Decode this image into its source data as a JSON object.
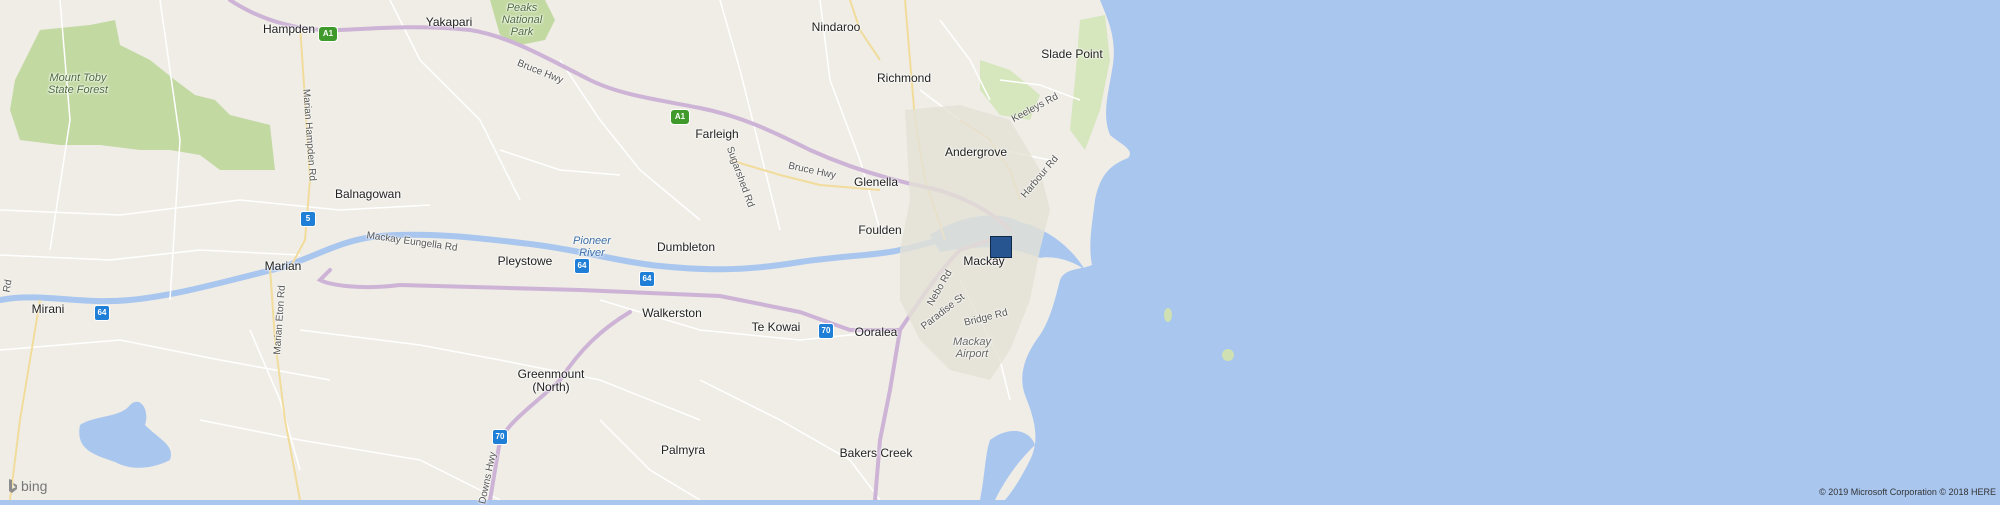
{
  "map": {
    "provider": "bing",
    "copyright": "© 2019 Microsoft Corporation © 2018 HERE",
    "colors": {
      "land": "#efede6",
      "sea": "#a9c6ef",
      "park": "#c3d9a2",
      "road_major": "#cdb3d6",
      "road_minor": "#ffffff",
      "marker": "#27558f"
    },
    "places": [
      {
        "id": "hampden",
        "name": "Hampden"
      },
      {
        "id": "yakapari",
        "name": "Yakapari"
      },
      {
        "id": "nindaroo",
        "name": "Nindaroo"
      },
      {
        "id": "slade-point",
        "name": "Slade Point"
      },
      {
        "id": "richmond",
        "name": "Richmond"
      },
      {
        "id": "farleigh",
        "name": "Farleigh"
      },
      {
        "id": "andergrove",
        "name": "Andergrove"
      },
      {
        "id": "glenella",
        "name": "Glenella"
      },
      {
        "id": "balnagowan",
        "name": "Balnagowan"
      },
      {
        "id": "foulden",
        "name": "Foulden"
      },
      {
        "id": "dumbleton",
        "name": "Dumbleton"
      },
      {
        "id": "pleystowe",
        "name": "Pleystowe"
      },
      {
        "id": "marian",
        "name": "Marian"
      },
      {
        "id": "mackay",
        "name": "Mackay"
      },
      {
        "id": "mirani",
        "name": "Mirani"
      },
      {
        "id": "walkerston",
        "name": "Walkerston"
      },
      {
        "id": "te-kowai",
        "name": "Te Kowai"
      },
      {
        "id": "ooralea",
        "name": "Ooralea"
      },
      {
        "id": "greenmount",
        "name": "Greenmount\n(North)"
      },
      {
        "id": "palmyra",
        "name": "Palmyra"
      },
      {
        "id": "bakers-creek",
        "name": "Bakers Creek"
      }
    ],
    "parks": [
      {
        "id": "mount-toby",
        "name": "Mount Toby\nState Forest"
      },
      {
        "id": "peaks-np",
        "name": "Peaks\nNational\nPark"
      }
    ],
    "water_labels": [
      {
        "id": "pioneer-river",
        "name": "Pioneer\nRiver"
      }
    ],
    "airports": [
      {
        "id": "mackay-airport",
        "name": "Mackay\nAirport"
      }
    ],
    "roads": [
      {
        "id": "bruce-hwy-1",
        "name": "Bruce Hwy"
      },
      {
        "id": "bruce-hwy-2",
        "name": "Bruce Hwy"
      },
      {
        "id": "marian-hampden-rd",
        "name": "Marian Hampden Rd"
      },
      {
        "id": "mackay-eungella-rd",
        "name": "Mackay Eungella Rd"
      },
      {
        "id": "marian-eton-rd",
        "name": "Marian Eton Rd"
      },
      {
        "id": "sugarshed-rd",
        "name": "Sugarshed Rd"
      },
      {
        "id": "keeleys-rd",
        "name": "Keeleys Rd"
      },
      {
        "id": "harbour-rd",
        "name": "Harbour Rd"
      },
      {
        "id": "nebo-rd",
        "name": "Nebo Rd"
      },
      {
        "id": "paradise-st",
        "name": "Paradise St"
      },
      {
        "id": "bridge-rd",
        "name": "Bridge Rd"
      },
      {
        "id": "downs-hwy",
        "name": "Downs Hwy"
      },
      {
        "id": "rd-edge",
        "name": "Rd"
      }
    ],
    "shields": [
      {
        "id": "a1-north",
        "label": "A1",
        "type": "green"
      },
      {
        "id": "a1-farleigh",
        "label": "A1",
        "type": "green"
      },
      {
        "id": "r5",
        "label": "5",
        "type": "blue"
      },
      {
        "id": "r64-a",
        "label": "64",
        "type": "blue"
      },
      {
        "id": "r64-b",
        "label": "64",
        "type": "blue"
      },
      {
        "id": "r64-c",
        "label": "64",
        "type": "blue"
      },
      {
        "id": "r70-a",
        "label": "70",
        "type": "blue"
      },
      {
        "id": "r70-b",
        "label": "70",
        "type": "blue"
      }
    ]
  }
}
